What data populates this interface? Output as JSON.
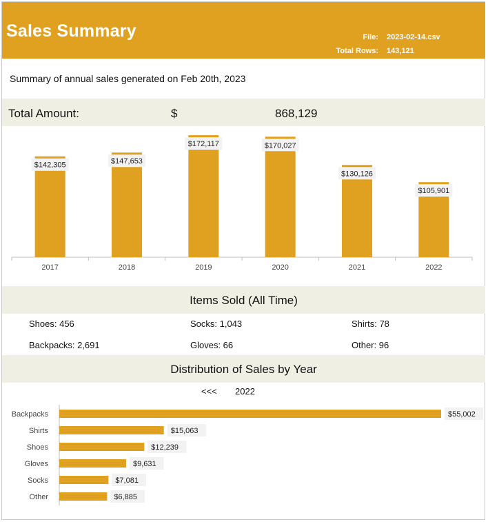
{
  "header": {
    "title": "Sales Summary",
    "file_label": "File:",
    "file_value": "2023-02-14.csv",
    "rows_label": "Total Rows:",
    "rows_value": "143,121"
  },
  "subtitle": "Summary of annual sales generated on Feb 20th, 2023",
  "total": {
    "label": "Total Amount:",
    "currency": "$",
    "value": "868,129"
  },
  "items_section": {
    "title": "Items Sold (All Time)",
    "items": [
      {
        "text": "Shoes: 456"
      },
      {
        "text": "Socks: 1,043"
      },
      {
        "text": "Shirts: 78"
      },
      {
        "text": "Backpacks: 2,691"
      },
      {
        "text": "Gloves: 66"
      },
      {
        "text": "Other: 96"
      }
    ]
  },
  "distribution": {
    "title": "Distribution of Sales by Year",
    "prev_label": "<<<",
    "year": "2022"
  },
  "colors": {
    "accent": "#e0a121",
    "band": "#f0efe4"
  },
  "chart_data": [
    {
      "type": "bar",
      "categories": [
        "2017",
        "2018",
        "2019",
        "2020",
        "2021",
        "2022"
      ],
      "values": [
        142305,
        147653,
        172117,
        170027,
        130126,
        105901
      ],
      "labels": [
        "$142,305",
        "$147,653",
        "$172,117",
        "$170,027",
        "$130,126",
        "$105,901"
      ],
      "title": "",
      "xlabel": "",
      "ylabel": "",
      "ylim": [
        0,
        180000
      ],
      "grid": false
    },
    {
      "type": "bar",
      "orientation": "horizontal",
      "categories": [
        "Backpacks",
        "Shirts",
        "Shoes",
        "Gloves",
        "Socks",
        "Other"
      ],
      "values": [
        55002,
        15063,
        12239,
        9631,
        7081,
        6885
      ],
      "labels": [
        "$55,002",
        "$15,063",
        "$12,239",
        "$9,631",
        "$7,081",
        "$6,885"
      ],
      "title": "",
      "xlabel": "",
      "ylabel": "",
      "xlim": [
        0,
        55002
      ],
      "grid": false
    }
  ]
}
